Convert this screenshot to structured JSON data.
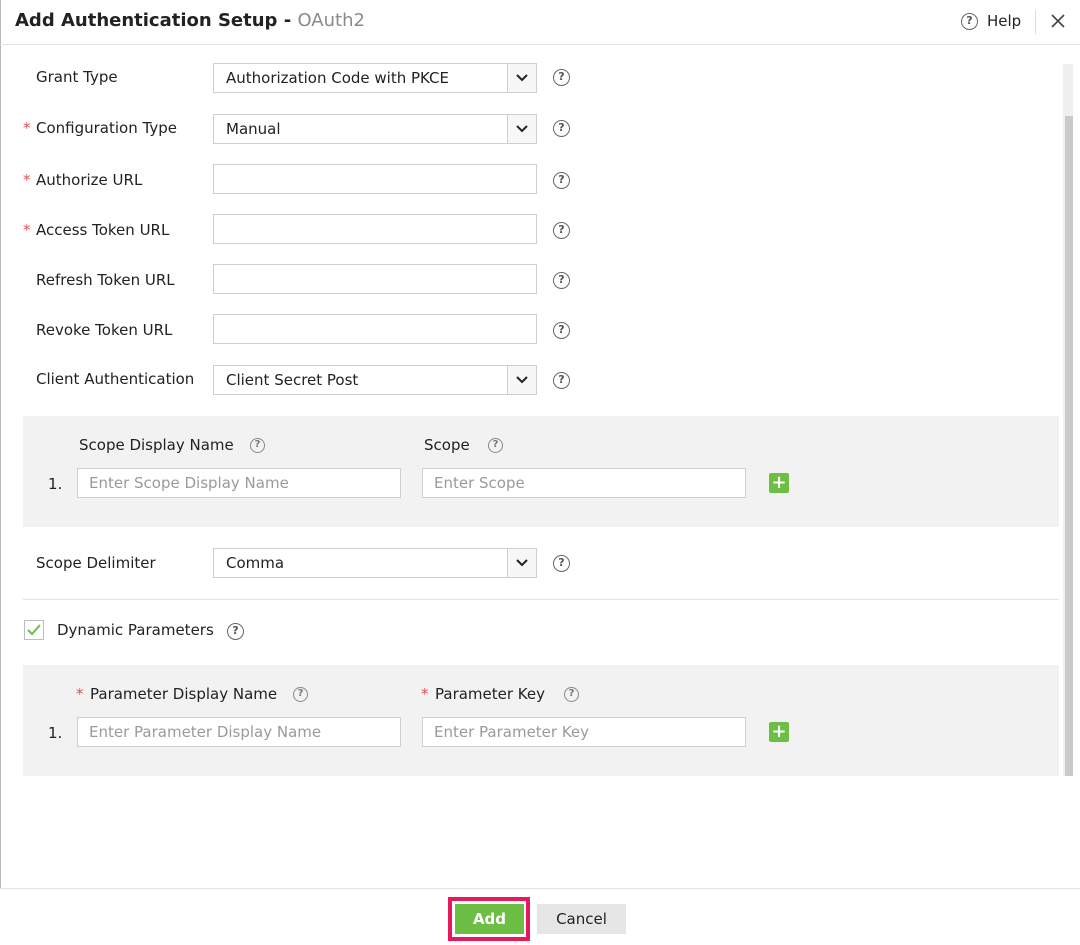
{
  "dialog": {
    "title": "Add Authentication Setup - ",
    "subtitle": "OAuth2",
    "help_label": "Help"
  },
  "form": {
    "grant_type": {
      "label": "Grant Type",
      "value": "Authorization Code with PKCE"
    },
    "configuration_type": {
      "label": "Configuration Type",
      "value": "Manual",
      "required": "*"
    },
    "authorize_url": {
      "label": "Authorize URL",
      "value": "",
      "required": "*"
    },
    "access_token_url": {
      "label": "Access Token URL",
      "value": "",
      "required": "*"
    },
    "refresh_token_url": {
      "label": "Refresh Token URL",
      "value": ""
    },
    "revoke_token_url": {
      "label": "Revoke Token URL",
      "value": ""
    },
    "client_authentication": {
      "label": "Client Authentication",
      "value": "Client Secret Post"
    },
    "scope_delimiter": {
      "label": "Scope Delimiter",
      "value": "Comma"
    }
  },
  "scopes": {
    "display_name_header": "Scope Display Name",
    "scope_header": "Scope",
    "rows": [
      {
        "number": "1.",
        "display_name_placeholder": "Enter Scope Display Name",
        "scope_placeholder": "Enter Scope"
      }
    ]
  },
  "dynamic_parameters": {
    "label": "Dynamic Parameters",
    "checked": true,
    "display_name_header": "Parameter Display Name",
    "key_header": "Parameter Key",
    "required": "*",
    "rows": [
      {
        "number": "1.",
        "display_name_placeholder": "Enter Parameter Display Name",
        "key_placeholder": "Enter Parameter Key"
      }
    ]
  },
  "footer": {
    "add_label": "Add",
    "cancel_label": "Cancel"
  },
  "colors": {
    "primary_green": "#6cbe45",
    "highlight": "#e8195b",
    "required": "#d9534f"
  }
}
